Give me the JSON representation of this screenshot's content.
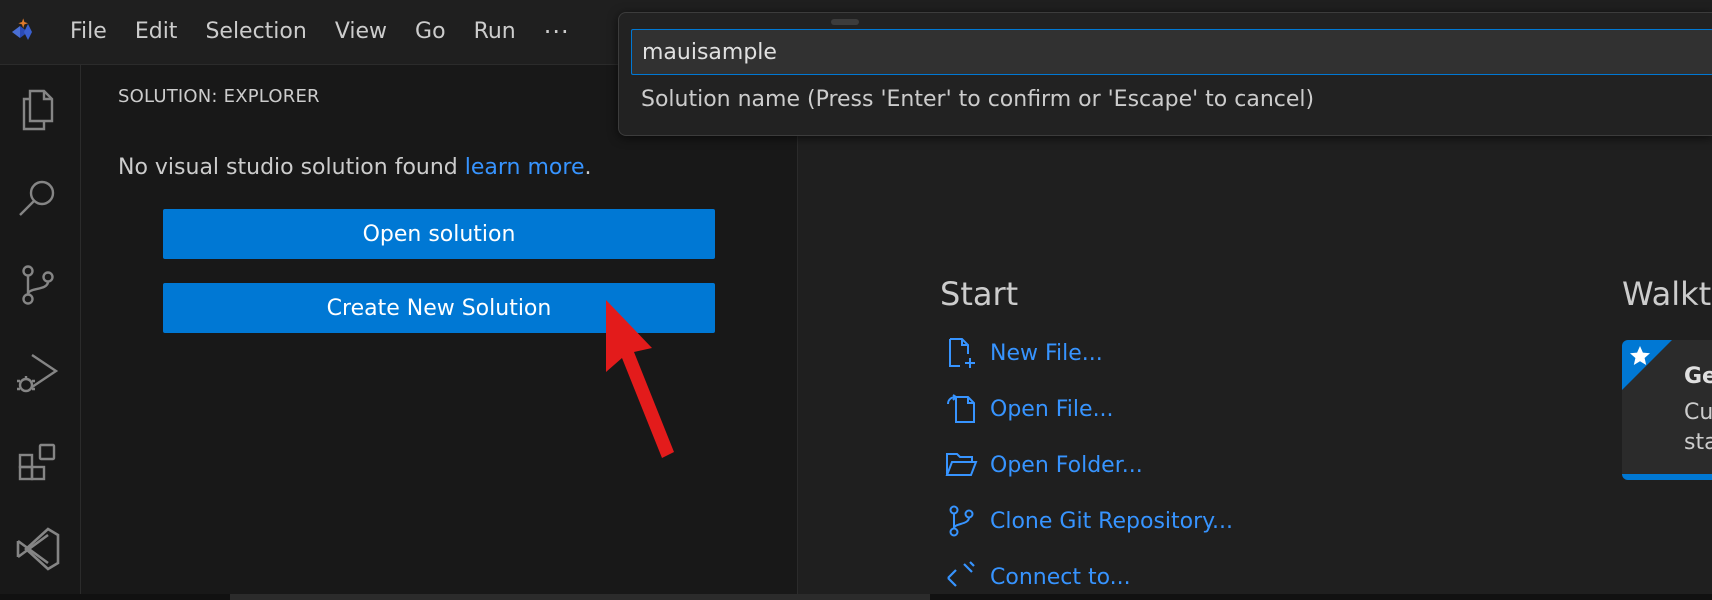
{
  "menu": {
    "items": [
      "File",
      "Edit",
      "Selection",
      "View",
      "Go",
      "Run"
    ],
    "more": "···"
  },
  "sidebar": {
    "title": "SOLUTION: EXPLORER",
    "no_solution_text": "No visual studio solution found ",
    "learn_more": "learn more",
    "period": ".",
    "open_solution": "Open solution",
    "create_solution": "Create New Solution"
  },
  "quick_input": {
    "value": "mauisample",
    "message": "Solution name (Press 'Enter' to confirm or 'Escape' to cancel)"
  },
  "welcome": {
    "start_title": "Start",
    "start_items": [
      "New File...",
      "Open File...",
      "Open Folder...",
      "Clone Git Repository...",
      "Connect to..."
    ],
    "walkthroughs_title": "Walkt",
    "walkthrough_card": {
      "title": "Ge",
      "desc_line1": "Cu",
      "desc_line2": "sta"
    }
  },
  "colors": {
    "accent": "#0078d4",
    "link": "#3794ff",
    "annotation": "#e31b1b"
  },
  "icons": {
    "activity": [
      "explorer-icon",
      "search-icon",
      "source-control-icon",
      "run-debug-icon",
      "extensions-icon",
      "visual-studio-icon"
    ]
  }
}
